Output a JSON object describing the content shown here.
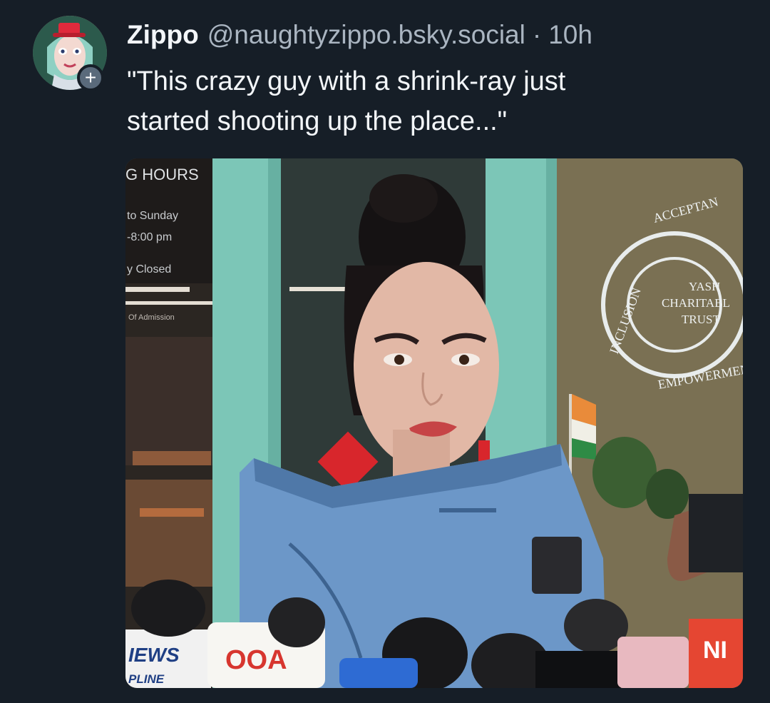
{
  "post": {
    "author_name": "Zippo",
    "author_handle": "@naughtyzippo.bsky.social",
    "separator": "·",
    "timestamp": "10h",
    "text": "\"This crazy guy with a shrink-ray just\nstarted shooting up the place...\"",
    "follow_badge": "+"
  },
  "media": {
    "sign_hours_title": "G HOURS",
    "sign_line1": "to Sunday",
    "sign_line2": "-8:00 pm",
    "sign_line3": "y Closed",
    "sign_line4": "Of Admission",
    "window_ring_top": "ACCEPTAN",
    "window_ring_left": "INCLUSION",
    "window_ring_bottom": "EMPOWERMENT",
    "window_center_line1": "YASH",
    "window_center_line2": "CHARITABL",
    "window_center_line3": "TRUST",
    "mic_news_top": "IEWS",
    "mic_news_bottom": "PLINE",
    "mic_right_label": "NI",
    "mic_center_label": "OOA"
  },
  "colors": {
    "background": "#161e27",
    "text_primary": "#f3f6f9",
    "text_secondary": "#aab5c1",
    "door_teal": "#7cc6b7"
  },
  "icons": {
    "follow_badge": "plus-icon"
  }
}
